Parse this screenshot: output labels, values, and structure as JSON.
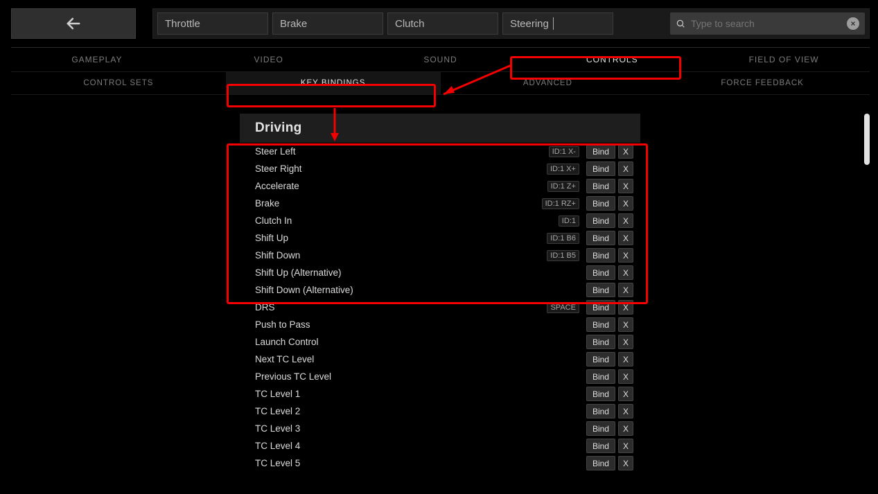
{
  "status": {
    "throttle": "Throttle",
    "brake": "Brake",
    "clutch": "Clutch",
    "steering": "Steering"
  },
  "search": {
    "placeholder": "Type to search"
  },
  "tabs": {
    "main": [
      "GAMEPLAY",
      "VIDEO",
      "SOUND",
      "CONTROLS",
      "FIELD OF VIEW"
    ],
    "sub": [
      "CONTROL SETS",
      "KEY BINDINGS",
      "ADVANCED",
      "FORCE FEEDBACK"
    ]
  },
  "section": {
    "title": "Driving"
  },
  "bind_label": "Bind",
  "clear_label": "X",
  "bindings": [
    {
      "name": "Steer Left",
      "chip": "ID:1 X-"
    },
    {
      "name": "Steer Right",
      "chip": "ID:1 X+"
    },
    {
      "name": "Accelerate",
      "chip": "ID:1 Z+"
    },
    {
      "name": "Brake",
      "chip": "ID:1 RZ+"
    },
    {
      "name": "Clutch In",
      "chip": "ID:1"
    },
    {
      "name": "Shift Up",
      "chip": "ID:1 B6"
    },
    {
      "name": "Shift Down",
      "chip": "ID:1 B5"
    },
    {
      "name": "Shift Up (Alternative)",
      "chip": ""
    },
    {
      "name": "Shift Down (Alternative)",
      "chip": ""
    },
    {
      "name": "DRS",
      "chip": "SPACE"
    },
    {
      "name": "Push to Pass",
      "chip": ""
    },
    {
      "name": "Launch Control",
      "chip": ""
    },
    {
      "name": "Next TC Level",
      "chip": ""
    },
    {
      "name": "Previous TC Level",
      "chip": ""
    },
    {
      "name": "TC Level 1",
      "chip": ""
    },
    {
      "name": "TC Level 2",
      "chip": ""
    },
    {
      "name": "TC Level 3",
      "chip": ""
    },
    {
      "name": "TC Level 4",
      "chip": ""
    },
    {
      "name": "TC Level 5",
      "chip": ""
    }
  ]
}
